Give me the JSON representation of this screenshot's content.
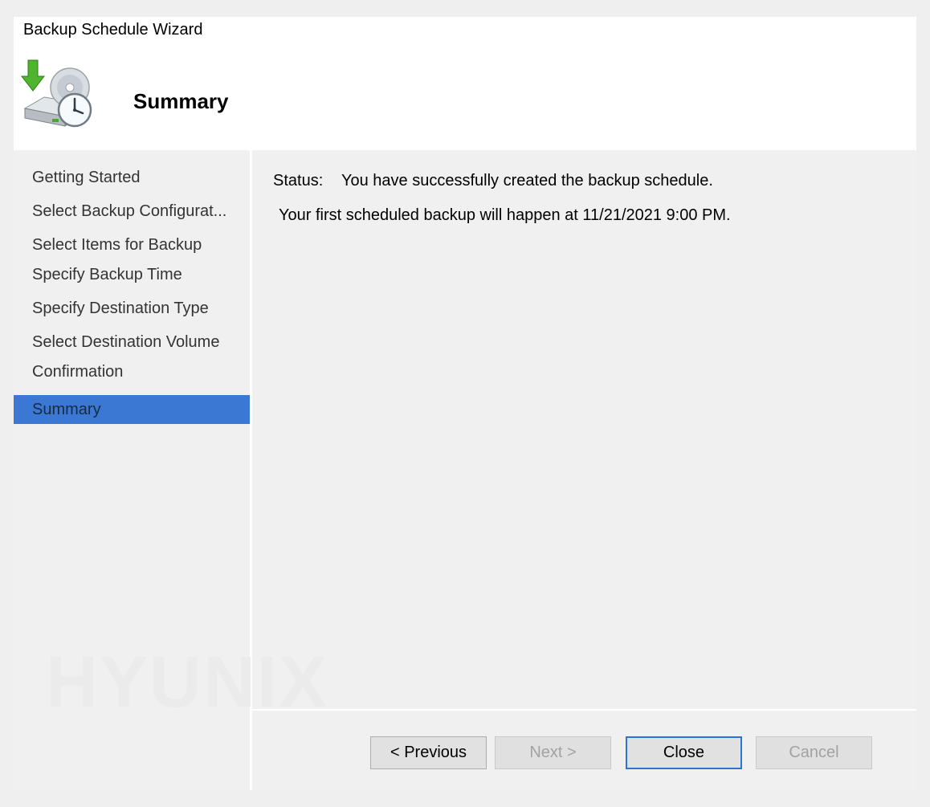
{
  "window": {
    "title": "Backup Schedule Wizard"
  },
  "header": {
    "icon": "backup-schedule-icon",
    "title": "Summary"
  },
  "steps": [
    {
      "label": "Getting Started"
    },
    {
      "label": "Select Backup Configurat..."
    },
    {
      "label": "Select Items for Backup"
    },
    {
      "label": "Specify Backup Time"
    },
    {
      "label": "Specify Destination Type"
    },
    {
      "label": "Select Destination Volume"
    },
    {
      "label": "Confirmation"
    },
    {
      "label": "Summary",
      "active": true
    }
  ],
  "content": {
    "status_label": "Status:",
    "status_text": "You have successfully created the backup schedule.",
    "schedule_text": "Your first scheduled backup will happen at 11/21/2021 9:00 PM."
  },
  "buttons": {
    "previous": "< Previous",
    "next": "Next >",
    "close": "Close",
    "cancel": "Cancel"
  },
  "watermark": "HYUNIX",
  "colors": {
    "selected_step": "#3a78d4",
    "default_button_border": "#2f73d0"
  }
}
